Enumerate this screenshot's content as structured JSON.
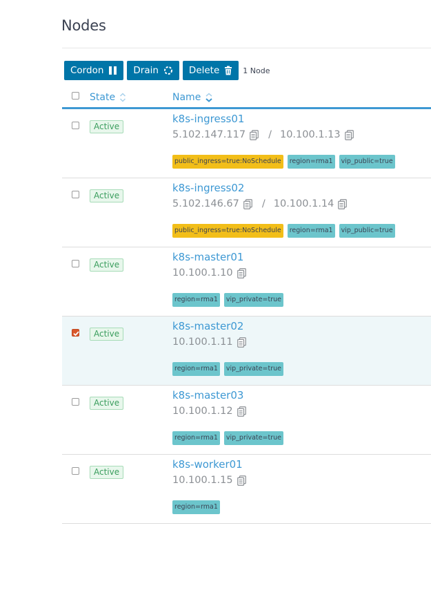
{
  "page": {
    "title": "Nodes"
  },
  "toolbar": {
    "cordon_label": "Cordon",
    "drain_label": "Drain",
    "delete_label": "Delete",
    "selection_count": "1 Node"
  },
  "table": {
    "columns": {
      "state": "State",
      "name": "Name"
    },
    "rows": [
      {
        "state": "Active",
        "name": "k8s-ingress01",
        "public_ip": "5.102.147.117",
        "separator": "/",
        "private_ip": "10.100.1.13",
        "checked": false,
        "tags": [
          {
            "text": "public_ingress=true:NoSchedule",
            "kind": "taint"
          },
          {
            "text": "region=rma1",
            "kind": "label"
          },
          {
            "text": "vip_public=true",
            "kind": "label"
          }
        ]
      },
      {
        "state": "Active",
        "name": "k8s-ingress02",
        "public_ip": "5.102.146.67",
        "separator": "/",
        "private_ip": "10.100.1.14",
        "checked": false,
        "tags": [
          {
            "text": "public_ingress=true:NoSchedule",
            "kind": "taint"
          },
          {
            "text": "region=rma1",
            "kind": "label"
          },
          {
            "text": "vip_public=true",
            "kind": "label"
          }
        ]
      },
      {
        "state": "Active",
        "name": "k8s-master01",
        "ip": "10.100.1.10",
        "checked": false,
        "tags": [
          {
            "text": "region=rma1",
            "kind": "label"
          },
          {
            "text": "vip_private=true",
            "kind": "label"
          }
        ]
      },
      {
        "state": "Active",
        "name": "k8s-master02",
        "ip": "10.100.1.11",
        "checked": true,
        "tags": [
          {
            "text": "region=rma1",
            "kind": "label"
          },
          {
            "text": "vip_private=true",
            "kind": "label"
          }
        ]
      },
      {
        "state": "Active",
        "name": "k8s-master03",
        "ip": "10.100.1.12",
        "checked": false,
        "tags": [
          {
            "text": "region=rma1",
            "kind": "label"
          },
          {
            "text": "vip_private=true",
            "kind": "label"
          }
        ]
      },
      {
        "state": "Active",
        "name": "k8s-worker01",
        "ip": "10.100.1.15",
        "checked": false,
        "tags": [
          {
            "text": "region=rma1",
            "kind": "label"
          }
        ]
      }
    ]
  },
  "colors": {
    "primary": "#0075a8",
    "link": "#3d98d3",
    "active_green": "#3a9d5d",
    "taint": "#f2be19",
    "label": "#6cc5cc",
    "checkbox_checked": "#d9582b"
  },
  "icons": {
    "cordon": "pause-icon",
    "drain": "refresh-icon",
    "delete": "trash-icon",
    "copy": "clipboard-icon",
    "sort": "sort-icon"
  }
}
